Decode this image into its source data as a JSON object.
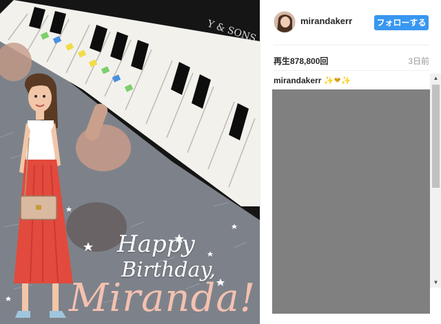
{
  "media": {
    "piano_brand": "Y & SONS",
    "text_happy": "Happy",
    "text_birthday": "Birthday,",
    "text_name": "Miranda!"
  },
  "post": {
    "username": "mirandakerr",
    "follow_label": "フォローする",
    "views": "再生878,800回",
    "time": "3日前",
    "caption_user": "mirandakerr",
    "caption_text": "✨❤✨"
  },
  "colors": {
    "follow_button": "#3897f0",
    "comments_placeholder": "#808080",
    "birthday_name": "#f4c1b0"
  }
}
